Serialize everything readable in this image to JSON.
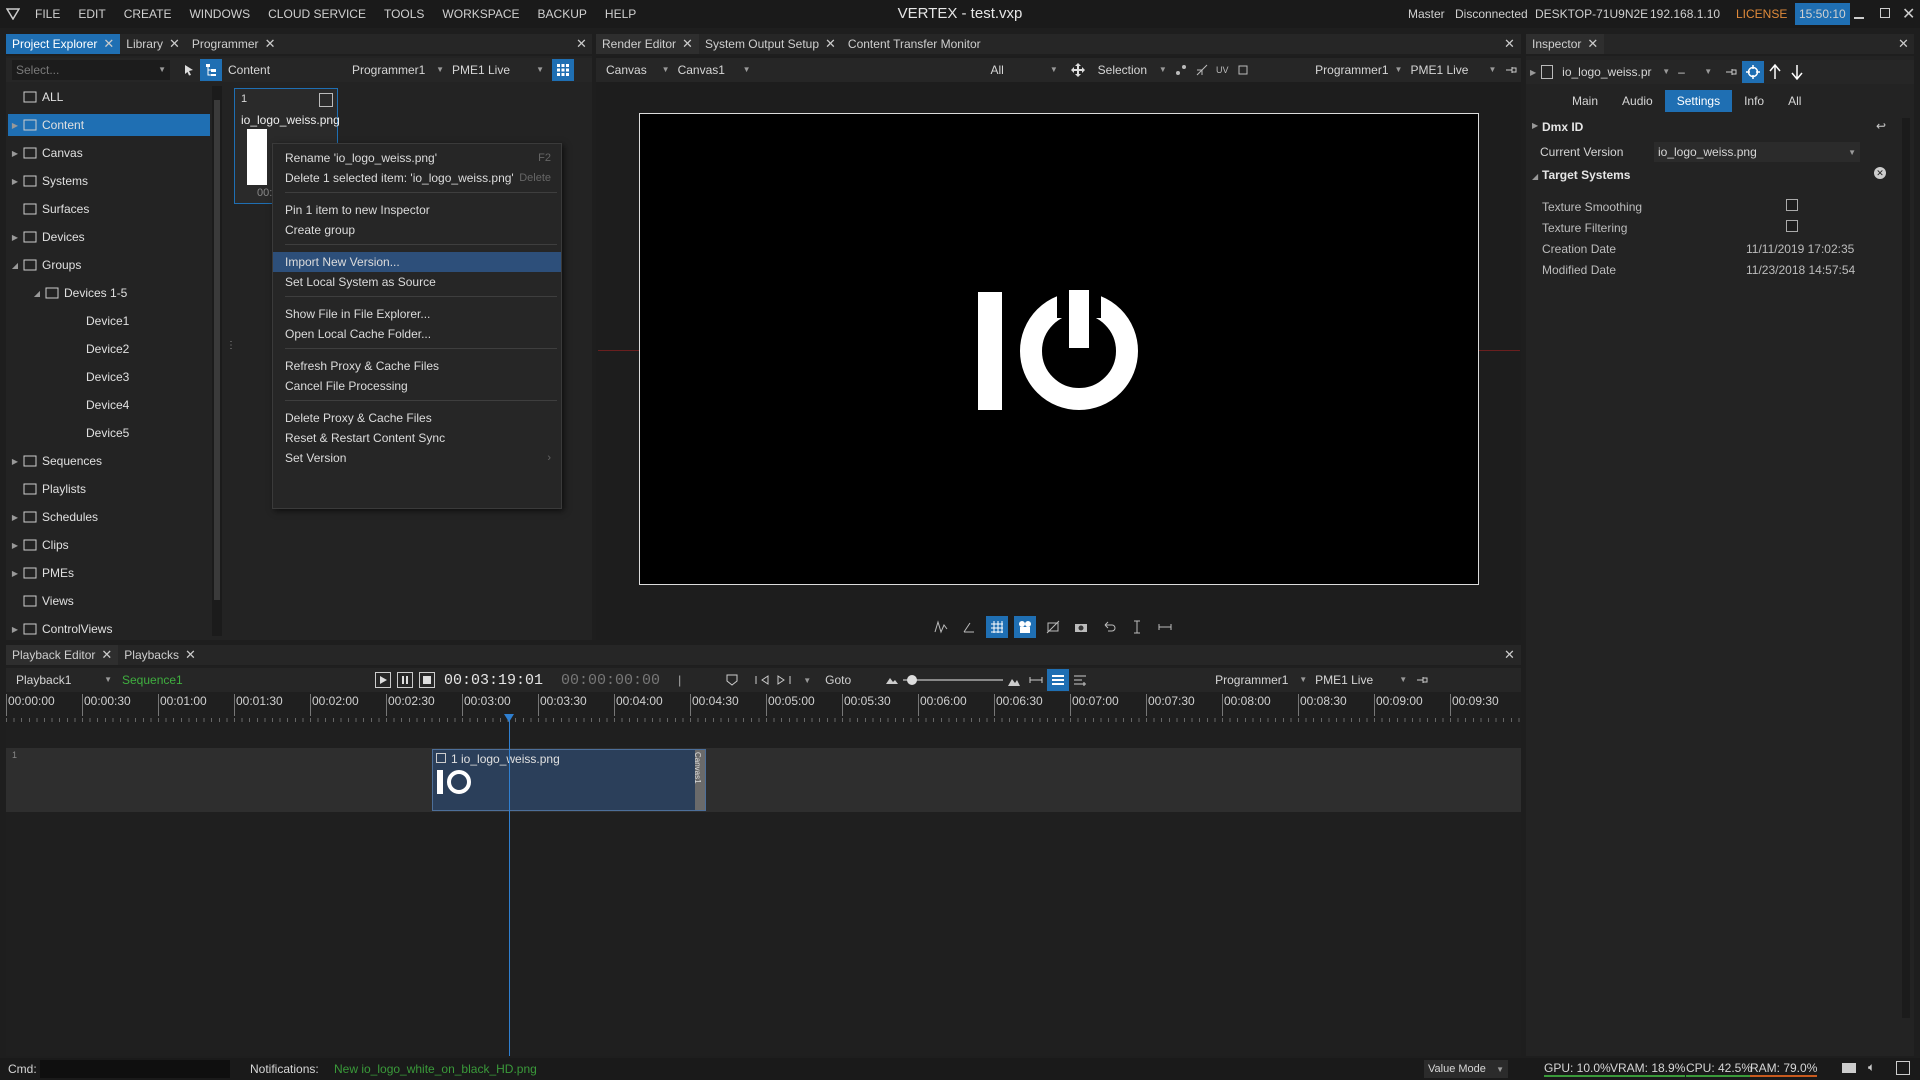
{
  "menu": {
    "items": [
      "FILE",
      "EDIT",
      "CREATE",
      "WINDOWS",
      "CLOUD SERVICE",
      "TOOLS",
      "WORKSPACE",
      "BACKUP",
      "HELP"
    ]
  },
  "window": {
    "title": "VERTEX - test.vxp",
    "role": "Master",
    "connection": "Disconnected",
    "machine": "DESKTOP-71U9N2E",
    "ip": "192.168.1.10",
    "license": "LICENSE",
    "clock": "15:50:10"
  },
  "left_tabs": [
    "Project Explorer",
    "Library",
    "Programmer"
  ],
  "left_toolbar": {
    "search_placeholder": "Select...",
    "content_label": "Content",
    "programmer": "Programmer1",
    "pme": "PME1 Live"
  },
  "tree": [
    {
      "label": "ALL",
      "expand": ""
    },
    {
      "label": "Content",
      "expand": "▶"
    },
    {
      "label": "Canvas",
      "expand": "▶"
    },
    {
      "label": "Systems",
      "expand": "▶"
    },
    {
      "label": "Surfaces",
      "expand": ""
    },
    {
      "label": "Devices",
      "expand": "▶"
    },
    {
      "label": "Groups",
      "expand": "◢"
    },
    {
      "label": "Devices 1-5",
      "expand": "◢"
    },
    {
      "label": "Device1",
      "expand": ""
    },
    {
      "label": "Device2",
      "expand": ""
    },
    {
      "label": "Device3",
      "expand": ""
    },
    {
      "label": "Device4",
      "expand": ""
    },
    {
      "label": "Device5",
      "expand": ""
    },
    {
      "label": "Sequences",
      "expand": "▶"
    },
    {
      "label": "Playlists",
      "expand": ""
    },
    {
      "label": "Schedules",
      "expand": "▶"
    },
    {
      "label": "Clips",
      "expand": "▶"
    },
    {
      "label": "PMEs",
      "expand": "▶"
    },
    {
      "label": "Views",
      "expand": ""
    },
    {
      "label": "ControlViews",
      "expand": "▶"
    }
  ],
  "content_item": {
    "index": "1",
    "name": "io_logo_weiss.png",
    "dur": "00:"
  },
  "context_menu": [
    {
      "label": "Rename 'io_logo_weiss.png'",
      "shortcut": "F2"
    },
    {
      "label": "Delete 1 selected item: 'io_logo_weiss.png'",
      "shortcut": "Delete"
    },
    {
      "label": "Pin 1 item to new Inspector",
      "shortcut": ""
    },
    {
      "label": "Create group",
      "shortcut": ""
    },
    {
      "label": "Import New Version...",
      "shortcut": ""
    },
    {
      "label": "Set Local System as Source",
      "shortcut": ""
    },
    {
      "label": "Show File in File Explorer...",
      "shortcut": ""
    },
    {
      "label": "Open Local Cache Folder...",
      "shortcut": ""
    },
    {
      "label": "Refresh Proxy & Cache Files",
      "shortcut": ""
    },
    {
      "label": "Cancel File Processing",
      "shortcut": ""
    },
    {
      "label": "Delete Proxy & Cache Files",
      "shortcut": ""
    },
    {
      "label": "Reset & Restart Content Sync",
      "shortcut": ""
    },
    {
      "label": "Set Version",
      "shortcut": "›"
    }
  ],
  "center_tabs": [
    "Render Editor",
    "System Output Setup",
    "Content Transfer Monitor"
  ],
  "render_toolbar": {
    "canvas_type": "Canvas",
    "canvas": "Canvas1",
    "filter": "All",
    "selection": "Selection",
    "programmer": "Programmer1",
    "pme": "PME1 Live"
  },
  "render_logo_text": "IO",
  "inspector": {
    "tab": "Inspector",
    "file": "io_logo_weiss.pr",
    "dash": "–",
    "subtabs": [
      "Main",
      "Audio",
      "Settings",
      "Info",
      "All"
    ],
    "dmx_label": "Dmx ID",
    "current_version_label": "Current Version",
    "current_version_value": "io_logo_weiss.png",
    "target_systems": "Target Systems",
    "props": [
      {
        "label": "Texture Smoothing",
        "value": ""
      },
      {
        "label": "Texture Filtering",
        "value": ""
      },
      {
        "label": "Creation Date",
        "value": "11/11/2019 17:02:35"
      },
      {
        "label": "Modified Date",
        "value": "11/23/2018 14:57:54"
      }
    ]
  },
  "bottom_tabs": [
    "Playback Editor",
    "Playbacks"
  ],
  "playback": {
    "playback": "Playback1",
    "sequence": "Sequence1",
    "time": "00:03:19:01",
    "time2": "00:00:00:00",
    "goto": "Goto",
    "programmer": "Programmer1",
    "pme": "PME1 Live"
  },
  "ruler": [
    "00:00:00",
    "00:00:30",
    "00:01:00",
    "00:01:30",
    "00:02:00",
    "00:02:30",
    "00:03:00",
    "00:03:30",
    "00:04:00",
    "00:04:30",
    "00:05:00",
    "00:05:30",
    "00:06:00",
    "00:06:30",
    "00:07:00",
    "00:07:30",
    "00:08:00",
    "00:08:30",
    "00:09:00",
    "00:09:30"
  ],
  "track": {
    "index": "1",
    "clip_label": "1 io_logo_weiss.png",
    "clip_side": "Canvas1"
  },
  "status": {
    "cmd": "Cmd:",
    "notifications": "Notifications:",
    "notification_text": "New io_logo_white_on_black_HD.png",
    "value_mode": "Value Mode",
    "gpu": "GPU: 10.0%",
    "vram": "VRAM: 18.9%",
    "cpu": "CPU: 42.5%",
    "ram": "RAM: 79.0%"
  },
  "colors": {
    "accent": "#1f6fb3",
    "notification": "#3a9a3a",
    "sequence": "#3fae3f",
    "ram_bar": "#c85a1e"
  }
}
